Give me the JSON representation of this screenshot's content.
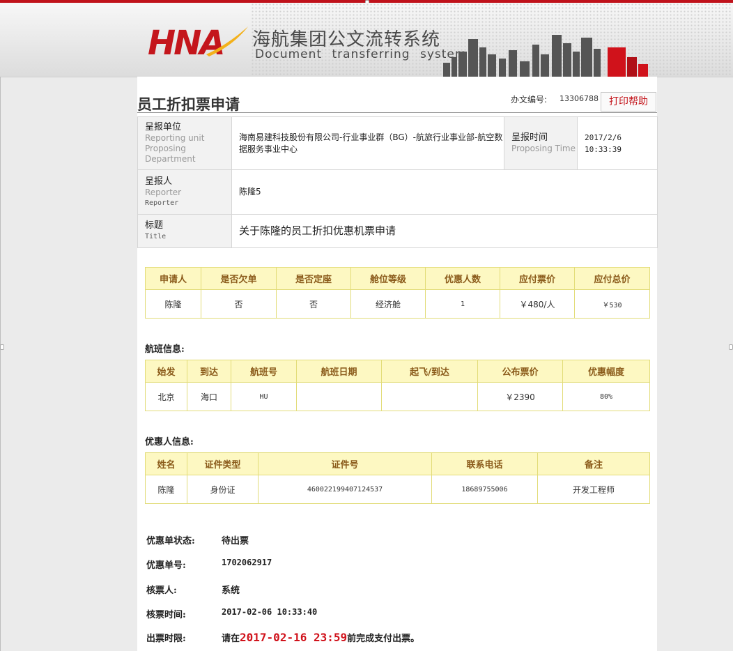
{
  "header": {
    "logo_text": "HNA",
    "system_title_cn": "海航集团公文流转系统",
    "system_title_en": "Document transferring system"
  },
  "page": {
    "title": "员工折扣票申请",
    "doc_no_label": "办文编号:",
    "doc_no_value": "13306788",
    "print_help_label": "打印帮助"
  },
  "info": {
    "unit_cn": "呈报单位",
    "unit_en1": "Reporting unit",
    "unit_en2": "Proposing Department",
    "unit_value": "海南易建科技股份有限公司-行业事业群（BG）-航旅行业事业部-航空数据服务事业中心",
    "time_cn": "呈报时间",
    "time_en": "Proposing Time",
    "time_date": "2017/2/6",
    "time_clock": "10:33:39",
    "reporter_cn": "呈报人",
    "reporter_en1": "Reporter",
    "reporter_en2": "Reporter",
    "reporter_value": "陈隆5",
    "title_cn": "标题",
    "title_en": "Title",
    "title_value": "关于陈隆的员工折扣优惠机票申请"
  },
  "application": {
    "headers": [
      "申请人",
      "是否欠单",
      "是否定座",
      "舱位等级",
      "优惠人数",
      "应付票价",
      "应付总价"
    ],
    "row": [
      "陈隆",
      "否",
      "否",
      "经济舱",
      "1",
      "￥480/人",
      "￥530"
    ]
  },
  "flight": {
    "section_label": "航班信息:",
    "headers": [
      "始发",
      "到达",
      "航班号",
      "航班日期",
      "起飞/到达",
      "公布票价",
      "优惠幅度"
    ],
    "row": [
      "北京",
      "海口",
      "HU",
      "",
      "",
      "￥2390",
      "80%"
    ]
  },
  "beneficiary": {
    "section_label": "优惠人信息:",
    "headers": [
      "姓名",
      "证件类型",
      "证件号",
      "联系电话",
      "备注"
    ],
    "row": [
      "陈隆",
      "身份证",
      "460022199407124537",
      "18689755006",
      "开发工程师"
    ]
  },
  "status": {
    "state_label": "优惠单状态:",
    "state_value": "待出票",
    "order_no_label": "优惠单号:",
    "order_no_value": "1702062917",
    "checker_label": "核票人:",
    "checker_value": "系统",
    "check_time_label": "核票时间:",
    "check_time_value": "2017-02-06 10:33:40",
    "deadline_label": "出票时限:",
    "deadline_prefix": "请在",
    "deadline_time": "2017-02-16 23:59",
    "deadline_suffix": "前完成支付出票。"
  },
  "colors": {
    "brand_red": "#c4161c",
    "table_header_bg": "#fdf8c2",
    "table_border": "#e2dc78",
    "table_header_text": "#8a5a1a",
    "deadline_red": "#d0121b"
  }
}
